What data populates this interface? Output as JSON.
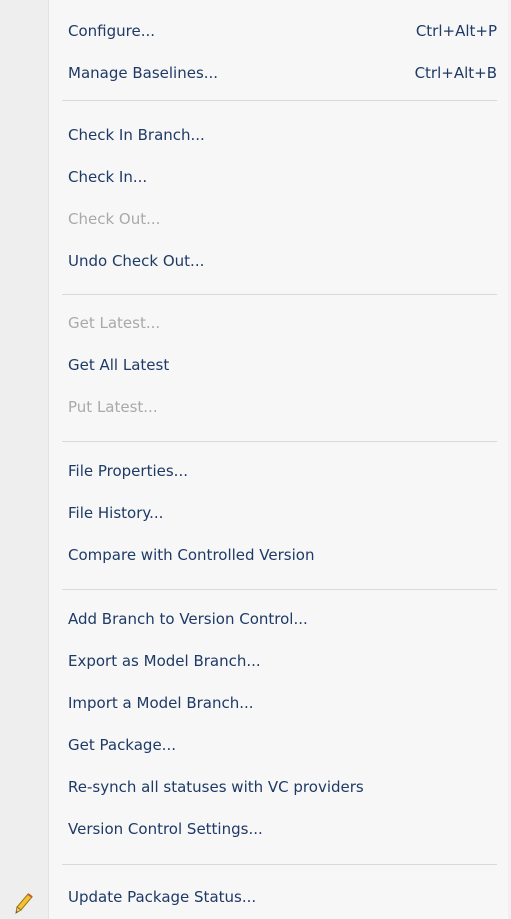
{
  "menu": {
    "items": [
      {
        "label": "Configure...",
        "shortcut": "Ctrl+Alt+P",
        "enabled": true
      },
      {
        "label": "Manage Baselines...",
        "shortcut": "Ctrl+Alt+B",
        "enabled": true
      },
      {
        "label": "Check In Branch...",
        "enabled": true
      },
      {
        "label": "Check In...",
        "enabled": true
      },
      {
        "label": "Check Out...",
        "enabled": false
      },
      {
        "label": "Undo Check Out...",
        "enabled": true
      },
      {
        "label": "Get Latest...",
        "enabled": false
      },
      {
        "label": "Get All Latest",
        "enabled": true
      },
      {
        "label": "Put Latest...",
        "enabled": false
      },
      {
        "label": "File Properties...",
        "enabled": true
      },
      {
        "label": "File History...",
        "enabled": true
      },
      {
        "label": "Compare with Controlled Version",
        "enabled": true
      },
      {
        "label": "Add Branch to Version Control...",
        "enabled": true
      },
      {
        "label": "Export as Model Branch...",
        "enabled": true
      },
      {
        "label": "Import a Model Branch...",
        "enabled": true
      },
      {
        "label": "Get Package...",
        "enabled": true
      },
      {
        "label": "Re-synch all statuses with VC providers",
        "enabled": true
      },
      {
        "label": "Version Control Settings...",
        "enabled": true
      },
      {
        "label": "Update Package Status...",
        "enabled": true,
        "icon": "pencil-icon"
      }
    ]
  },
  "colors": {
    "text": "#1e3a66",
    "disabled_text": "#a9a9a9",
    "gutter": "#eeeeee",
    "background": "#f7f7f7"
  }
}
